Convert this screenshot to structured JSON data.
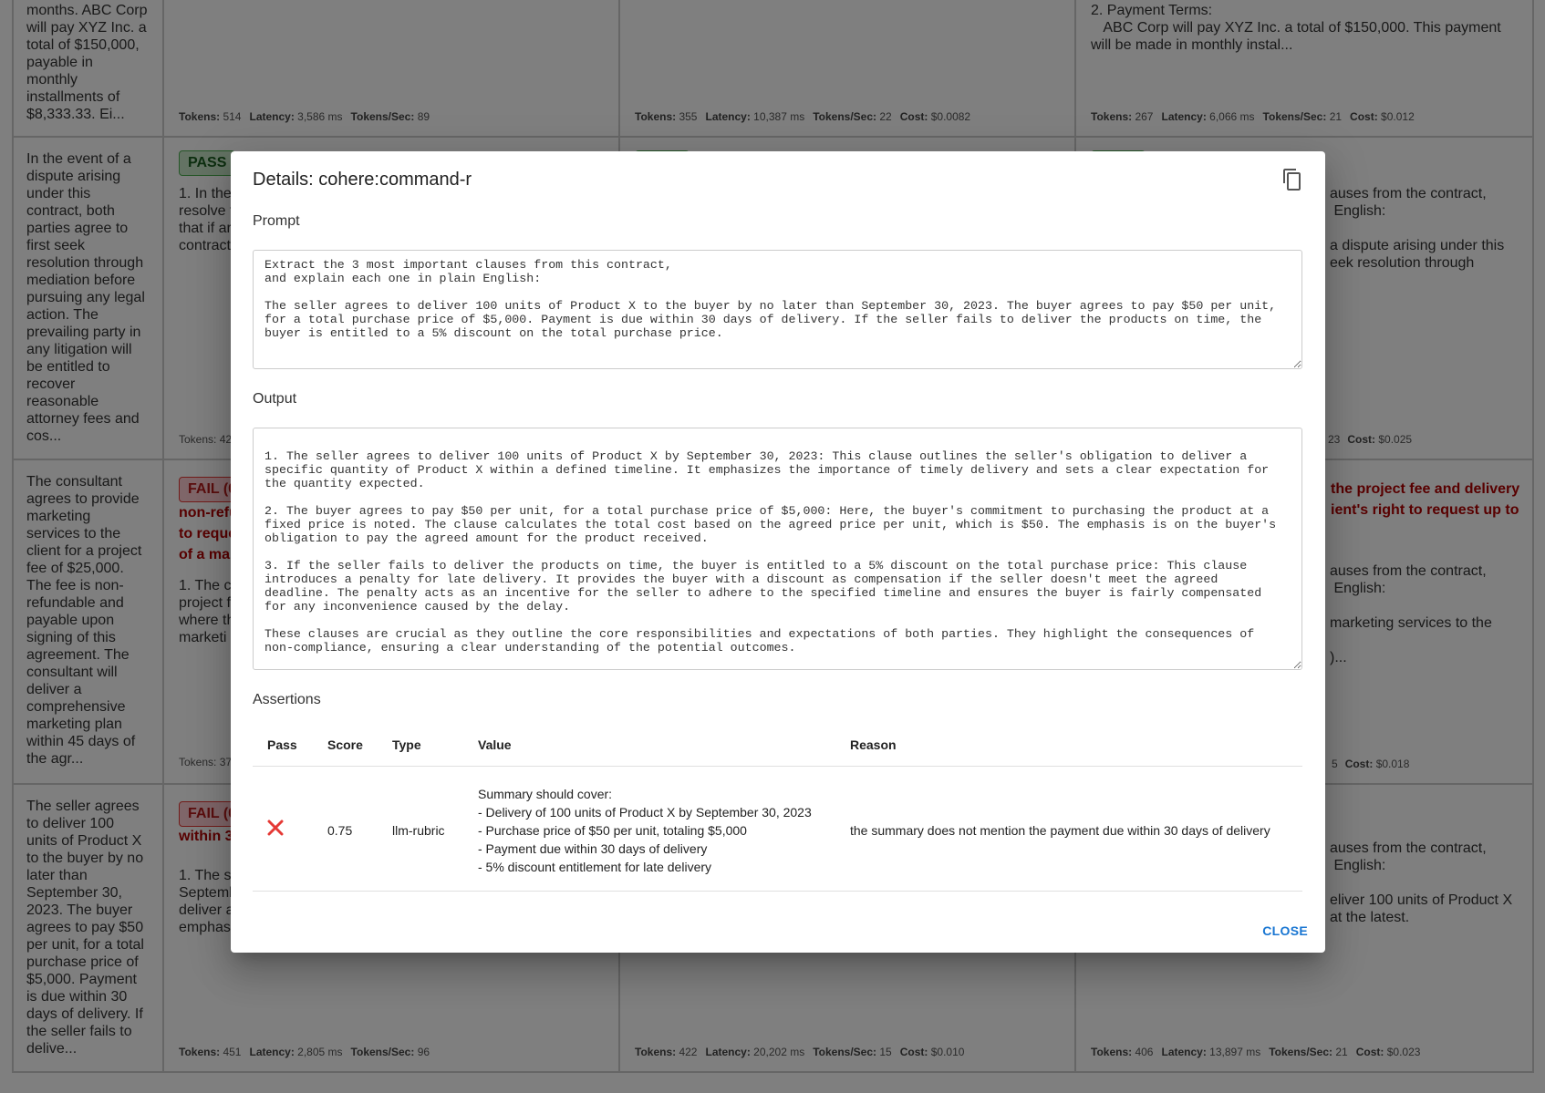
{
  "grid": {
    "row0": {
      "prompt_text": "months. ABC Corp\nwill pay XYZ Inc. a\ntotal of $150,000,\npayable in\nmonthly\ninstallments of\n$8,333.33. Ei...",
      "col2_metrics": [
        {
          "label": "Tokens:",
          "value": "514"
        },
        {
          "label": "Latency:",
          "value": "3,586 ms"
        },
        {
          "label": "Tokens/Sec:",
          "value": "89"
        }
      ],
      "col3_metrics": [
        {
          "label": "Tokens:",
          "value": "355"
        },
        {
          "label": "Latency:",
          "value": "10,387 ms"
        },
        {
          "label": "Tokens/Sec:",
          "value": "22"
        },
        {
          "label": "Cost:",
          "value": "$0.0082"
        }
      ],
      "col4_text": "2. Payment Terms:\n   ABC Corp will pay XYZ Inc. a total of $150,000. This payment\nwill be made in monthly instal...",
      "col4_metrics": [
        {
          "label": "Tokens:",
          "value": "267"
        },
        {
          "label": "Latency:",
          "value": "6,066 ms"
        },
        {
          "label": "Tokens/Sec:",
          "value": "21"
        },
        {
          "label": "Cost:",
          "value": "$0.012"
        }
      ]
    },
    "row1": {
      "prompt_text": "In the event of a\ndispute arising\nunder this\ncontract, both\nparties agree to\nfirst seek\nresolution through\nmediation before\npursuing any legal\naction. The\nprevailing party in\nany litigation will\nbe entitled to\nrecover\nreasonable\nattorney fees and\ncos...",
      "col2_badge": "PASS",
      "col2_text": "1. In the\nresolve t\nthat if ar\ncontract",
      "col2_metrics_partial": "Tokens: 42",
      "col4_text": "auses from the contract,\n English:\n\na dispute arising under this\neek resolution through",
      "col4_metrics_partial": "23",
      "col4_cost_label": "Cost:",
      "col4_cost_value": "$0.025"
    },
    "row2": {
      "prompt_text": "The consultant\nagrees to provide\nmarketing\nservices to the\nclient for a project\nfee of $25,000.\nThe fee is non-\nrefundable and\npayable upon\nsigning of this\nagreement. The\nconsultant will\ndeliver a\ncomprehensive\nmarketing plan\nwithin 45 days of\nthe agr...",
      "col2_badge": "FAIL (0",
      "col2_fail_reason": "non-refu\nto reque\nof a mar",
      "col2_text": "1. The c\nproject f\nwhere th\nmarketi",
      "col2_metrics_partial": "Tokens: 37",
      "col4_fail_reason": "the project fee and delivery\nient's right to request up to",
      "col4_text": "auses from the contract,\n English:\n\nmarketing services to the\n\n)...",
      "col4_metrics_partial": "5",
      "col4_cost_label": "Cost:",
      "col4_cost_value": "$0.018"
    },
    "row3": {
      "prompt_text": "The seller agrees\nto deliver 100\nunits of Product X\nto the buyer by no\nlater than\nSeptember 30,\n2023. The buyer\nagrees to pay $50\nper unit, for a total\npurchase price of\n$5,000. Payment\nis due within 30\ndays of delivery. If\nthe seller fails to\ndelive...",
      "col2_badge": "FAIL (0",
      "col2_fail_reason": "within 3",
      "col2_text": "1. The s\nSeptemb\ndeliver a\nemphas",
      "col2_metrics": [
        {
          "label": "Tokens:",
          "value": "451"
        },
        {
          "label": "Latency:",
          "value": "2,805 ms"
        },
        {
          "label": "Tokens/Sec:",
          "value": "96"
        }
      ],
      "col3_metrics": [
        {
          "label": "Tokens:",
          "value": "422"
        },
        {
          "label": "Latency:",
          "value": "20,202 ms"
        },
        {
          "label": "Tokens/Sec:",
          "value": "15"
        },
        {
          "label": "Cost:",
          "value": "$0.010"
        }
      ],
      "col4_text": "auses from the contract,\n English:\n\neliver 100 units of Product X\nat the latest.",
      "col4_metrics": [
        {
          "label": "Tokens:",
          "value": "406"
        },
        {
          "label": "Latency:",
          "value": "13,897 ms"
        },
        {
          "label": "Tokens/Sec:",
          "value": "21"
        },
        {
          "label": "Cost:",
          "value": "$0.023"
        }
      ]
    }
  },
  "dialog": {
    "title": "Details: cohere:command-r",
    "copy_icon": "content-copy-icon",
    "prompt_label": "Prompt",
    "prompt_value": "Extract the 3 most important clauses from this contract,\nand explain each one in plain English:\n\nThe seller agrees to deliver 100 units of Product X to the buyer by no later than September 30, 2023. The buyer agrees to pay $50 per unit,\nfor a total purchase price of $5,000. Payment is due within 30 days of delivery. If the seller fails to deliver the products on time, the\nbuyer is entitled to a 5% discount on the total purchase price.",
    "output_label": "Output",
    "output_value": "\n1. The seller agrees to deliver 100 units of Product X by September 30, 2023: This clause outlines the seller's obligation to deliver a\nspecific quantity of Product X within a defined timeline. It emphasizes the importance of timely delivery and sets a clear expectation for\nthe quantity expected.\n\n2. The buyer agrees to pay $50 per unit, for a total purchase price of $5,000: Here, the buyer's commitment to purchasing the product at a\nfixed price is noted. The clause calculates the total cost based on the agreed price per unit, which is $50. The emphasis is on the buyer's\nobligation to pay the agreed amount for the product received.\n\n3. If the seller fails to deliver the products on time, the buyer is entitled to a 5% discount on the total purchase price: This clause\nintroduces a penalty for late delivery. It provides the buyer with a discount as compensation if the seller doesn't meet the agreed\ndeadline. The penalty acts as an incentive for the seller to adhere to the specified timeline and ensures the buyer is fairly compensated\nfor any inconvenience caused by the delay.\n\nThese clauses are crucial as they outline the core responsibilities and expectations of both parties. They highlight the consequences of\nnon-compliance, ensuring a clear understanding of the potential outcomes.",
    "assertions_label": "Assertions",
    "assertions": {
      "headers": [
        "Pass",
        "Score",
        "Type",
        "Value",
        "Reason"
      ],
      "rows": [
        {
          "pass_icon": "x-mark-icon",
          "pass_color": "#e53935",
          "score": "0.75",
          "type": "llm-rubric",
          "value": "Summary should cover:\n- Delivery of 100 units of Product X by September 30, 2023\n- Purchase price of $50 per unit, totaling $5,000\n- Payment due within 30 days of delivery\n- 5% discount entitlement for late delivery",
          "reason": "the summary does not mention the payment due within 30 days of delivery"
        }
      ]
    },
    "close_label": "CLOSE"
  }
}
